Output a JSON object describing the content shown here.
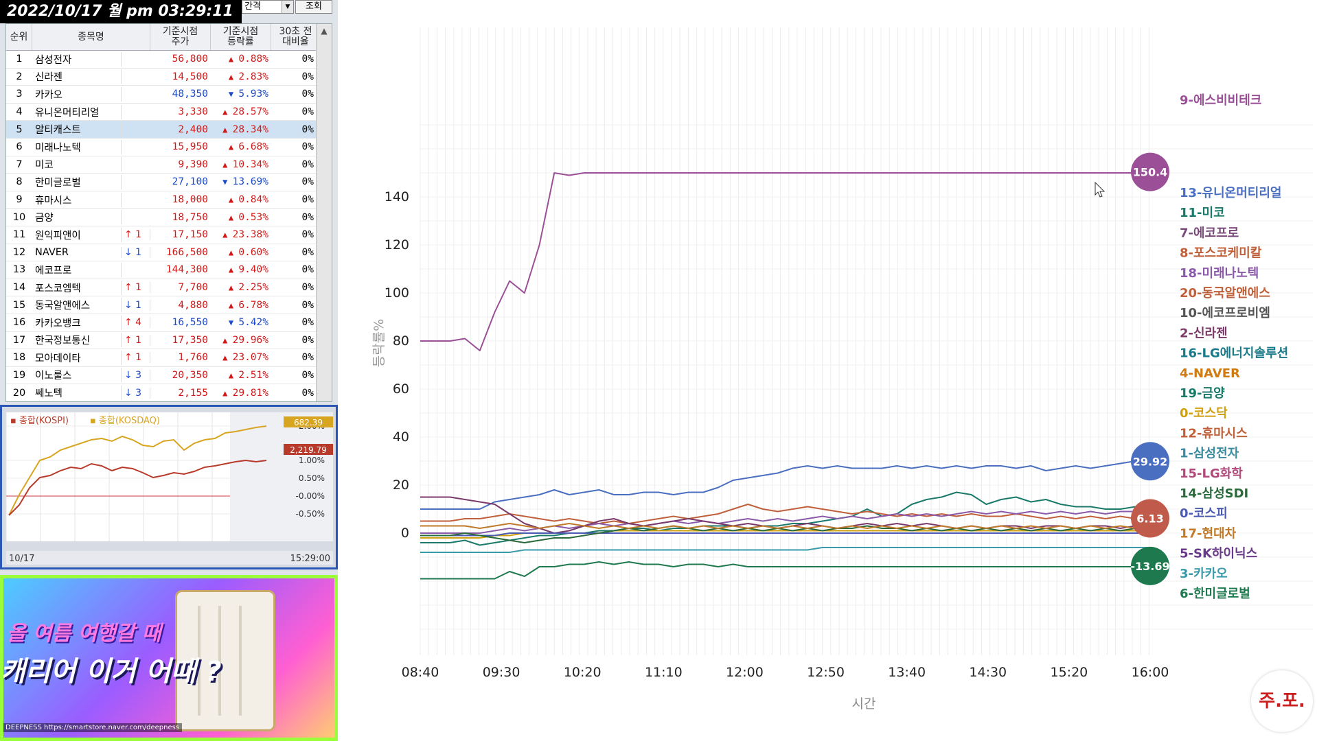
{
  "clock": "2022/10/17 월 pm 03:29:11",
  "controls": {
    "interval_label": "간격",
    "query_button": "조회"
  },
  "table": {
    "headers": [
      "순위",
      "종목명",
      "기준시점\n주가",
      "기준시점\n등락률",
      "30초 전\n대비율"
    ],
    "rows": [
      {
        "rank": "1",
        "name": "삼성전자",
        "chg": "",
        "price": "56,800",
        "dir": "up",
        "rate": "0.88%",
        "d30": "0%"
      },
      {
        "rank": "2",
        "name": "신라젠",
        "chg": "",
        "price": "14,500",
        "dir": "up",
        "rate": "2.83%",
        "d30": "0%"
      },
      {
        "rank": "3",
        "name": "카카오",
        "chg": "",
        "price": "48,350",
        "dir": "down",
        "rate": "5.93%",
        "d30": "0%"
      },
      {
        "rank": "4",
        "name": "유니온머티리얼",
        "chg": "",
        "price": "3,330",
        "dir": "up",
        "rate": "28.57%",
        "d30": "0%"
      },
      {
        "rank": "5",
        "name": "알티캐스트",
        "chg": "",
        "price": "2,400",
        "dir": "up",
        "rate": "28.34%",
        "d30": "0%"
      },
      {
        "rank": "6",
        "name": "미래나노텍",
        "chg": "",
        "price": "15,950",
        "dir": "up",
        "rate": "6.68%",
        "d30": "0%"
      },
      {
        "rank": "7",
        "name": "미코",
        "chg": "",
        "price": "9,390",
        "dir": "up",
        "rate": "10.34%",
        "d30": "0%"
      },
      {
        "rank": "8",
        "name": "한미글로벌",
        "chg": "",
        "price": "27,100",
        "dir": "down",
        "rate": "13.69%",
        "d30": "0%"
      },
      {
        "rank": "9",
        "name": "휴마시스",
        "chg": "",
        "price": "18,000",
        "dir": "up",
        "rate": "0.84%",
        "d30": "0%"
      },
      {
        "rank": "10",
        "name": "금양",
        "chg": "",
        "price": "18,750",
        "dir": "up",
        "rate": "0.53%",
        "d30": "0%"
      },
      {
        "rank": "11",
        "name": "원익피앤이",
        "chg": "↑ 1",
        "price": "17,150",
        "dir": "up",
        "rate": "23.38%",
        "d30": "0%"
      },
      {
        "rank": "12",
        "name": "NAVER",
        "chg": "↓ 1",
        "price": "166,500",
        "dir": "up",
        "rate": "0.60%",
        "d30": "0%"
      },
      {
        "rank": "13",
        "name": "에코프로",
        "chg": "",
        "price": "144,300",
        "dir": "up",
        "rate": "9.40%",
        "d30": "0%"
      },
      {
        "rank": "14",
        "name": "포스코엠텍",
        "chg": "↑ 1",
        "price": "7,700",
        "dir": "up",
        "rate": "2.25%",
        "d30": "0%"
      },
      {
        "rank": "15",
        "name": "동국알앤에스",
        "chg": "↓ 1",
        "price": "4,880",
        "dir": "up",
        "rate": "6.78%",
        "d30": "0%"
      },
      {
        "rank": "16",
        "name": "카카오뱅크",
        "chg": "↑ 4",
        "price": "16,550",
        "dir": "down",
        "rate": "5.42%",
        "d30": "0%"
      },
      {
        "rank": "17",
        "name": "한국정보통신",
        "chg": "↑ 1",
        "price": "17,350",
        "dir": "up",
        "rate": "29.96%",
        "d30": "0%"
      },
      {
        "rank": "18",
        "name": "모아데이타",
        "chg": "↑ 1",
        "price": "1,760",
        "dir": "up",
        "rate": "23.07%",
        "d30": "0%"
      },
      {
        "rank": "19",
        "name": "이노룰스",
        "chg": "↓ 3",
        "price": "20,350",
        "dir": "up",
        "rate": "2.51%",
        "d30": "0%"
      },
      {
        "rank": "20",
        "name": "쎄노텍",
        "chg": "↓ 3",
        "price": "2,155",
        "dir": "up",
        "rate": "29.81%",
        "d30": "0%"
      }
    ]
  },
  "index_chart": {
    "legend_kospi": "종합(KOSPI)",
    "legend_kosdaq": "종합(KOSDAQ)",
    "kosdaq_value": "682.39",
    "kospi_value": "2,219.79",
    "y_ticks": [
      "2.00%",
      "1.00%",
      "0.50%",
      "-0.00%",
      "-0.50%"
    ],
    "date_label": "10/17",
    "time_label": "15:29:00",
    "colors": {
      "kospi": "#b83a2a",
      "kosdaq": "#d8a520"
    }
  },
  "ad": {
    "line1": "올 여름 여행갈 때",
    "line2": "캐리어 이거 어때 ?",
    "url": "DEEPNESS https://smartstore.naver.com/deepness"
  },
  "logo": "주.포.",
  "chart_data": {
    "type": "line",
    "xlabel": "시간",
    "ylabel": "등락률%",
    "x_ticks": [
      "08:40",
      "09:30",
      "10:20",
      "11:10",
      "12:00",
      "12:50",
      "13:40",
      "14:30",
      "15:20",
      "16:00"
    ],
    "y_ticks": [
      0,
      20,
      40,
      60,
      80,
      100,
      120,
      140
    ],
    "ylim": [
      -40,
      175
    ],
    "end_badges": [
      {
        "label": "150.4",
        "value": 150.4,
        "color": "#9a4f96"
      },
      {
        "label": "29.92",
        "value": 29.92,
        "color": "#4a6fc0"
      },
      {
        "label": "6.13",
        "value": 6.13,
        "color": "#c05a4a"
      },
      {
        "label": "-13.69",
        "value": -13.69,
        "color": "#1e7a4e"
      }
    ],
    "legend": [
      {
        "name": "9-에스비비테크",
        "color": "#9a4f96"
      },
      {
        "name": "13-유니온머티리얼",
        "color": "#4a6fc0"
      },
      {
        "name": "11-미코",
        "color": "#1a7a6a"
      },
      {
        "name": "7-에코프로",
        "color": "#7a4a7a"
      },
      {
        "name": "8-포스코케미칼",
        "color": "#c0603a"
      },
      {
        "name": "18-미래나노텍",
        "color": "#8a5aa8"
      },
      {
        "name": "20-동국알앤에스",
        "color": "#c0603a"
      },
      {
        "name": "10-에코프로비엠",
        "color": "#555555"
      },
      {
        "name": "2-신라젠",
        "color": "#7a3a6a"
      },
      {
        "name": "16-LG에너지솔루션",
        "color": "#1a7a8a"
      },
      {
        "name": "4-NAVER",
        "color": "#d07a10"
      },
      {
        "name": "19-금양",
        "color": "#1a7a6a"
      },
      {
        "name": "0-코스닥",
        "color": "#d0a010"
      },
      {
        "name": "12-휴마시스",
        "color": "#c0603a"
      },
      {
        "name": "1-삼성전자",
        "color": "#3a8aa0"
      },
      {
        "name": "15-LG화학",
        "color": "#b04a7a"
      },
      {
        "name": "14-삼성SDI",
        "color": "#2a6a3a"
      },
      {
        "name": "0-코스피",
        "color": "#4a5ab0"
      },
      {
        "name": "17-현대차",
        "color": "#c07a2a"
      },
      {
        "name": "5-SK하이닉스",
        "color": "#6a3a8a"
      },
      {
        "name": "3-카카오",
        "color": "#3a9aa8"
      },
      {
        "name": "6-한미글로벌",
        "color": "#1e7a4e"
      }
    ],
    "series": [
      {
        "color": "#9a4f96",
        "values": [
          80,
          80,
          80,
          81,
          76,
          92,
          105,
          100,
          120,
          150,
          149,
          150,
          150,
          150,
          150,
          150,
          150,
          150,
          150,
          150,
          150,
          150,
          150,
          150,
          150,
          150,
          150,
          150,
          150,
          150,
          150,
          150,
          150,
          150,
          150,
          150,
          150,
          150,
          150,
          150,
          150,
          150,
          150,
          150,
          150,
          150,
          150,
          150,
          150,
          150.4
        ]
      },
      {
        "color": "#4a6fc0",
        "values": [
          10,
          10,
          10,
          10,
          10,
          13,
          14,
          15,
          16,
          18,
          16,
          17,
          18,
          16,
          16,
          17,
          17,
          16,
          17,
          17,
          19,
          22,
          23,
          24,
          25,
          27,
          28,
          27,
          28,
          27,
          27,
          27,
          28,
          27,
          28,
          27,
          28,
          27,
          28,
          28,
          27,
          28,
          26,
          27,
          28,
          27,
          28,
          29,
          30,
          29.92
        ]
      },
      {
        "color": "#1a7a6a",
        "values": [
          -4,
          -4,
          -4,
          -3,
          -5,
          -4,
          -3,
          -2,
          -1,
          -1,
          0,
          0,
          1,
          1,
          2,
          2,
          1,
          2,
          2,
          3,
          3,
          3,
          2,
          3,
          3,
          4,
          4,
          5,
          6,
          7,
          10,
          7,
          8,
          12,
          14,
          15,
          17,
          16,
          12,
          14,
          15,
          13,
          14,
          12,
          11,
          11,
          10,
          10,
          11,
          11
        ]
      },
      {
        "color": "#c0603a",
        "values": [
          5,
          5,
          5,
          6,
          6,
          7,
          8,
          7,
          6,
          5,
          6,
          5,
          4,
          5,
          4,
          5,
          6,
          7,
          6,
          7,
          8,
          10,
          12,
          10,
          9,
          10,
          11,
          10,
          9,
          8,
          9,
          8,
          7,
          8,
          7,
          8,
          7,
          8,
          7,
          7,
          8,
          7,
          6,
          7,
          6,
          7,
          6,
          7,
          6,
          6.13
        ]
      },
      {
        "color": "#8a5aa8",
        "values": [
          0,
          0,
          0,
          0,
          0,
          1,
          2,
          1,
          2,
          3,
          2,
          3,
          4,
          3,
          4,
          3,
          4,
          5,
          4,
          5,
          4,
          5,
          6,
          5,
          6,
          5,
          6,
          7,
          6,
          7,
          6,
          7,
          8,
          7,
          8,
          7,
          8,
          9,
          8,
          9,
          8,
          9,
          8,
          9,
          8,
          9,
          8,
          9,
          9,
          9
        ]
      },
      {
        "color": "#1e7a4e",
        "values": [
          -19,
          -19,
          -19,
          -19,
          -19,
          -19,
          -16,
          -18,
          -14,
          -14,
          -13,
          -13,
          -12,
          -13,
          -12,
          -13,
          -13,
          -14,
          -13,
          -13,
          -14,
          -13,
          -14,
          -14,
          -14,
          -14,
          -14,
          -14,
          -14,
          -14,
          -14,
          -14,
          -14,
          -14,
          -14,
          -14,
          -14,
          -14,
          -14,
          -14,
          -14,
          -14,
          -14,
          -14,
          -14,
          -14,
          -14,
          -14,
          -14,
          -13.69
        ]
      },
      {
        "color": "#3a9aa8",
        "values": [
          -8,
          -8,
          -8,
          -8,
          -8,
          -8,
          -8,
          -7,
          -7,
          -7,
          -7,
          -7,
          -7,
          -7,
          -7,
          -7,
          -7,
          -7,
          -7,
          -7,
          -7,
          -7,
          -7,
          -7,
          -7,
          -7,
          -7,
          -6,
          -6,
          -6,
          -6,
          -6,
          -6,
          -6,
          -6,
          -6,
          -6,
          -6,
          -6,
          -6,
          -6,
          -6,
          -6,
          -6,
          -6,
          -6,
          -6,
          -6,
          -6,
          -6
        ]
      },
      {
        "color": "#7a3a6a",
        "values": [
          15,
          15,
          15,
          14,
          13,
          12,
          8,
          4,
          2,
          0,
          1,
          3,
          5,
          6,
          4,
          3,
          4,
          5,
          6,
          5,
          4,
          3,
          4,
          3,
          2,
          3,
          4,
          3,
          2,
          3,
          4,
          3,
          4,
          3,
          4,
          3,
          2,
          3,
          2,
          3,
          3,
          2,
          3,
          3,
          2,
          3,
          3,
          2,
          3,
          3
        ]
      },
      {
        "color": "#d0a010",
        "values": [
          -2,
          -2,
          -2,
          -2,
          -2,
          -1,
          -1,
          0,
          0,
          0,
          0,
          0,
          0,
          1,
          1,
          1,
          1,
          1,
          1,
          1,
          1,
          1,
          1,
          1,
          1,
          1,
          1,
          1,
          1,
          1,
          1,
          1,
          1,
          1,
          1,
          1,
          1,
          1,
          1,
          1,
          1,
          1,
          1,
          1,
          1,
          1,
          1,
          1,
          1,
          1
        ]
      },
      {
        "color": "#4a5ab0",
        "values": [
          -1,
          -1,
          -1,
          -1,
          -1,
          -1,
          0,
          0,
          0,
          0,
          0,
          0,
          0,
          0,
          0,
          0,
          0,
          0,
          0,
          0,
          0,
          0,
          0,
          0,
          0,
          0,
          0,
          0,
          0,
          0,
          0,
          0,
          0,
          0,
          0,
          0,
          0,
          0,
          0,
          0,
          0,
          0,
          0,
          0,
          0,
          0,
          0,
          0,
          0,
          0
        ]
      },
      {
        "color": "#2a6a3a",
        "values": [
          -1,
          -1,
          -1,
          0,
          -1,
          -2,
          -3,
          -4,
          -3,
          -2,
          -2,
          -1,
          0,
          1,
          2,
          1,
          2,
          3,
          2,
          1,
          2,
          1,
          2,
          1,
          2,
          1,
          2,
          1,
          2,
          2,
          3,
          2,
          2,
          1,
          2,
          1,
          2,
          1,
          2,
          1,
          2,
          1,
          2,
          1,
          2,
          1,
          2,
          1,
          2,
          2
        ]
      },
      {
        "color": "#c07a2a",
        "values": [
          3,
          3,
          3,
          3,
          2,
          3,
          4,
          3,
          2,
          3,
          4,
          3,
          2,
          3,
          2,
          3,
          2,
          3,
          2,
          3,
          2,
          3,
          2,
          3,
          2,
          3,
          2,
          3,
          2,
          3,
          2,
          3,
          2,
          3,
          2,
          3,
          2,
          3,
          2,
          3,
          2,
          3,
          2,
          3,
          2,
          3,
          2,
          3,
          2,
          2
        ]
      }
    ]
  }
}
